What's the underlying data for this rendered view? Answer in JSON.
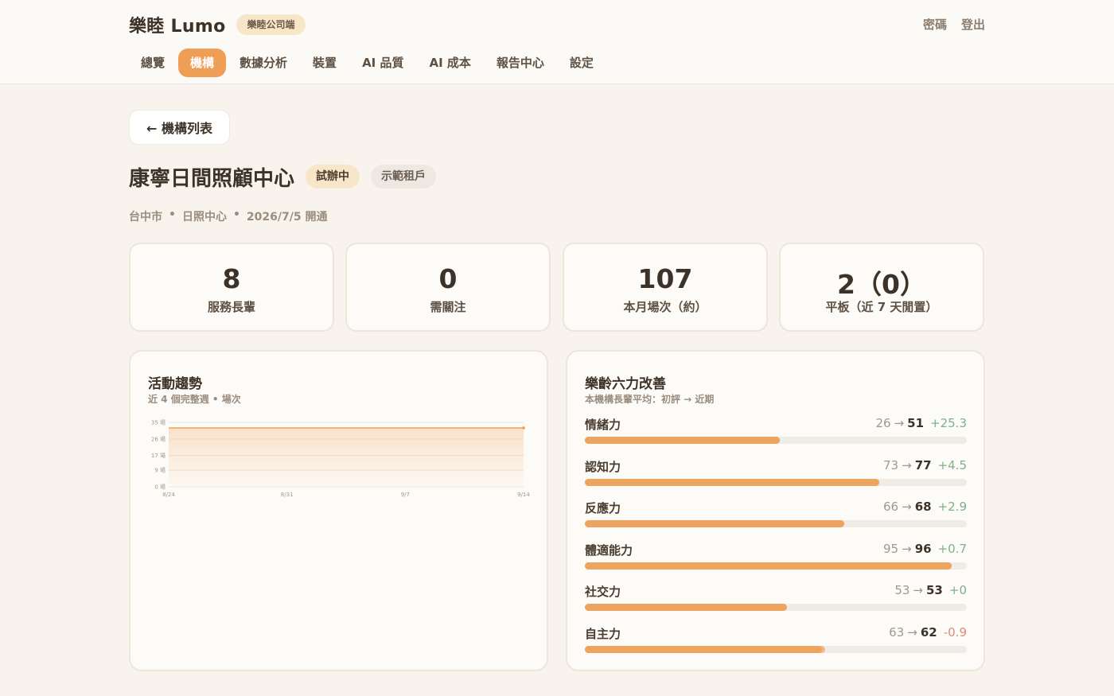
{
  "header": {
    "brand": "樂睦 Lumo",
    "badge": "樂睦公司端",
    "links": [
      "密碼",
      "登出"
    ],
    "tabs": [
      {
        "label": "總覽",
        "active": false
      },
      {
        "label": "機構",
        "active": true
      },
      {
        "label": "數據分析",
        "active": false
      },
      {
        "label": "裝置",
        "active": false
      },
      {
        "label": "AI 品質",
        "active": false
      },
      {
        "label": "AI 成本",
        "active": false
      },
      {
        "label": "報告中心",
        "active": false
      },
      {
        "label": "設定",
        "active": false
      }
    ]
  },
  "back_label": "← 機構列表",
  "org": {
    "name": "康寧日間照顧中心",
    "status": "試辦中",
    "tenant": "示範租戶",
    "meta": [
      "台中市",
      "•",
      "日照中心",
      "•",
      "2026/7/5 開通"
    ]
  },
  "stats": [
    {
      "value": "8",
      "label": "服務長輩"
    },
    {
      "value": "0",
      "label": "需關注"
    },
    {
      "value": "107",
      "label": "本月場次（約）"
    },
    {
      "value": "2（0）",
      "label": "平板（近 7 天閒置）"
    }
  ],
  "activity": {
    "title": "活動趨勢",
    "subtitle": "近 4 個完整週 • 場次"
  },
  "chart_data": {
    "type": "area",
    "x": [
      "8/24",
      "8/31",
      "9/7",
      "9/14"
    ],
    "y_ticks": [
      "35 場",
      "26 場",
      "17 場",
      "9 場",
      "0 場"
    ],
    "y_tick_values": [
      35,
      26,
      17,
      9,
      0
    ],
    "ylim": [
      0,
      35
    ],
    "series": [
      {
        "values": [
          32,
          32,
          32,
          32
        ]
      }
    ],
    "grid": true,
    "color": "#ef9f55"
  },
  "abilities": {
    "title": "樂齡六力改善",
    "subtitle": "本機構長輩平均：初評 → 近期",
    "items": [
      {
        "name": "情緒力",
        "from": "26",
        "to": "51",
        "delta": "+25.3"
      },
      {
        "name": "認知力",
        "from": "73",
        "to": "77",
        "delta": "+4.5"
      },
      {
        "name": "反應力",
        "from": "66",
        "to": "68",
        "delta": "+2.9"
      },
      {
        "name": "體適能力",
        "from": "95",
        "to": "96",
        "delta": "+0.7"
      },
      {
        "name": "社交力",
        "from": "53",
        "to": "53",
        "delta": "+0"
      },
      {
        "name": "自主力",
        "from": "63",
        "to": "62",
        "delta": "-0.9"
      }
    ]
  },
  "colors": {
    "accent": "#ef9f55",
    "background": "#f8f4ed",
    "positive": "#7fb08a",
    "negative": "#df8a78"
  }
}
